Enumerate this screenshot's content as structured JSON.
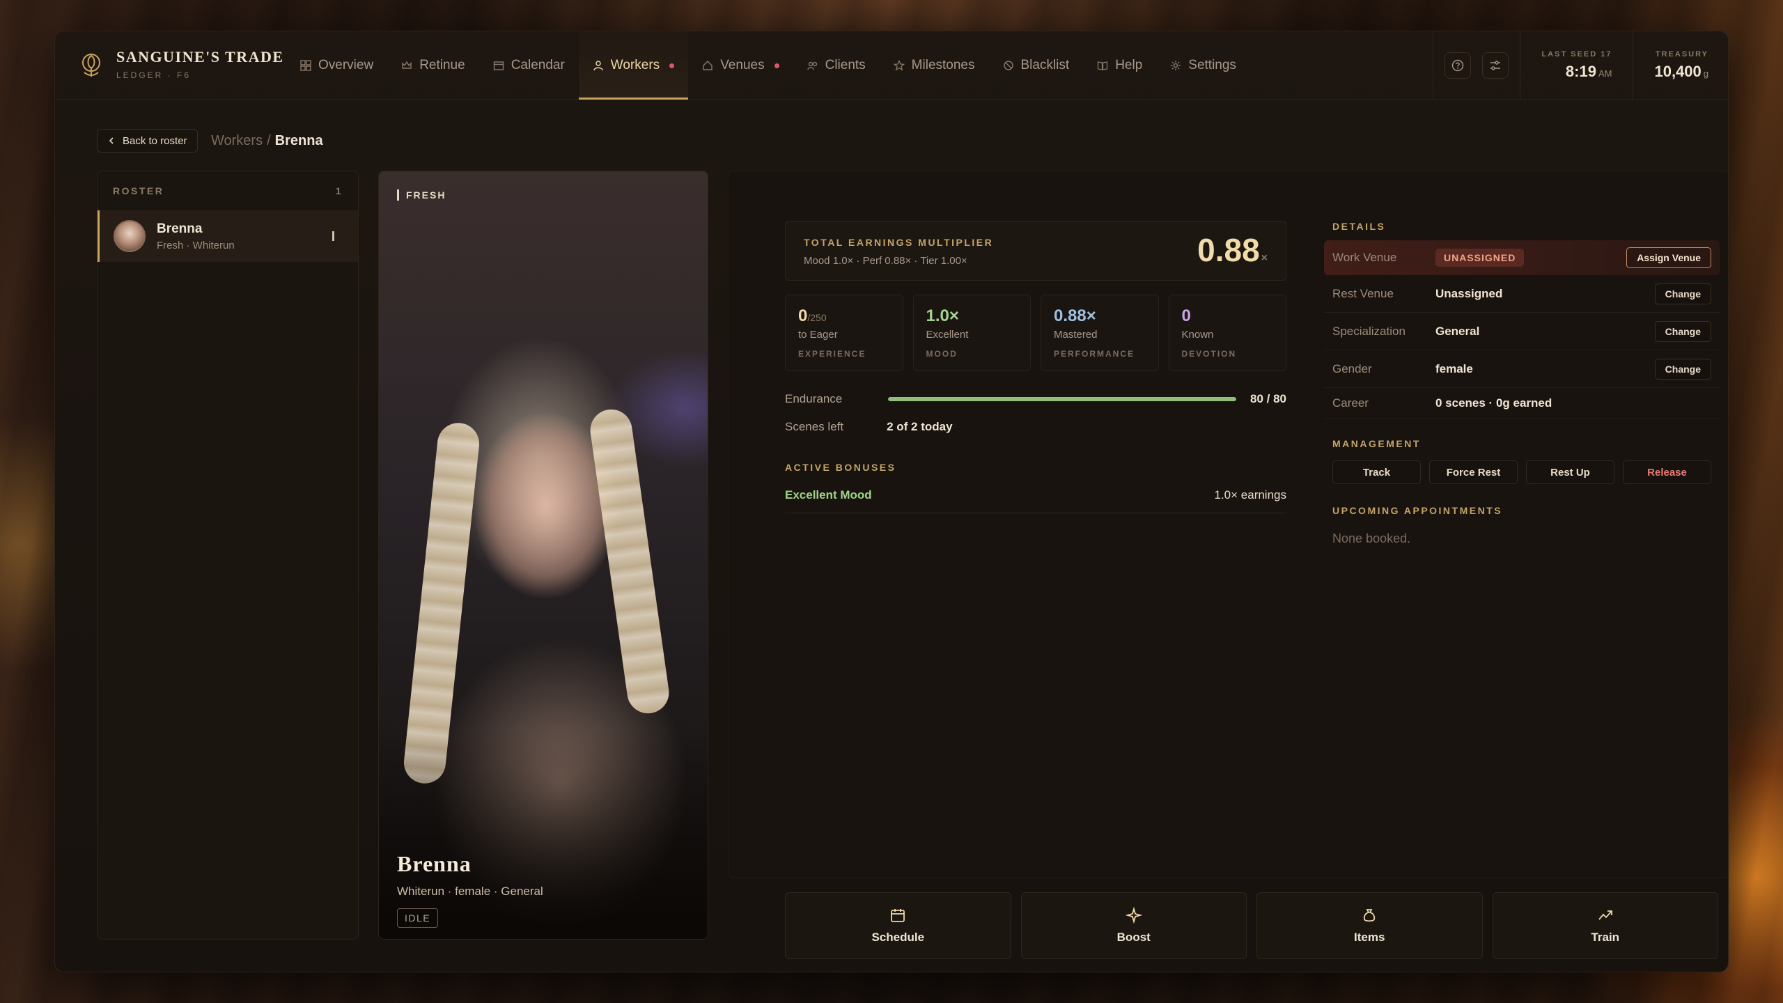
{
  "brand": {
    "title": "SANGUINE'S TRADE",
    "subtitle": "LEDGER · F6"
  },
  "nav": [
    {
      "label": "Overview",
      "icon": "grid-icon",
      "active": false,
      "dot": false
    },
    {
      "label": "Retinue",
      "icon": "crown-icon",
      "active": false,
      "dot": false
    },
    {
      "label": "Calendar",
      "icon": "calendar-icon",
      "active": false,
      "dot": false
    },
    {
      "label": "Workers",
      "icon": "person-icon",
      "active": true,
      "dot": true
    },
    {
      "label": "Venues",
      "icon": "house-icon",
      "active": false,
      "dot": true
    },
    {
      "label": "Clients",
      "icon": "people-icon",
      "active": false,
      "dot": false
    },
    {
      "label": "Milestones",
      "icon": "star-icon",
      "active": false,
      "dot": false
    },
    {
      "label": "Blacklist",
      "icon": "ban-icon",
      "active": false,
      "dot": false
    },
    {
      "label": "Help",
      "icon": "book-icon",
      "active": false,
      "dot": false
    },
    {
      "label": "Settings",
      "icon": "gear-icon",
      "active": false,
      "dot": false
    }
  ],
  "status": {
    "last_seed_label": "LAST SEED 17",
    "time": "8:19",
    "ampm": "AM",
    "treasury_label": "TREASURY",
    "treasury": "10,400",
    "treasury_unit": "g"
  },
  "breadcrumb": {
    "back": "Back to roster",
    "parent": "Workers",
    "sep": "/",
    "current": "Brenna"
  },
  "roster": {
    "title": "ROSTER",
    "count": "1",
    "items": [
      {
        "name": "Brenna",
        "sub": "Fresh · Whiterun"
      }
    ]
  },
  "portrait": {
    "tag": "FRESH",
    "name": "Brenna",
    "sub": "Whiterun · female · General",
    "badge": "IDLE"
  },
  "multiplier": {
    "label": "TOTAL EARNINGS MULTIPLIER",
    "breakdown": "Mood 1.0× · Perf 0.88× · Tier 1.00×",
    "value": "0.88",
    "suffix": "×"
  },
  "stats": [
    {
      "value": "0",
      "suffix": "/250",
      "sub": "to Eager",
      "label": "EXPERIENCE",
      "color": "#f1dba8"
    },
    {
      "value": "1.0×",
      "suffix": "",
      "sub": "Excellent",
      "label": "MOOD",
      "color": "#a6d38f"
    },
    {
      "value": "0.88×",
      "suffix": "",
      "sub": "Mastered",
      "label": "PERFORMANCE",
      "color": "#9cc0e0"
    },
    {
      "value": "0",
      "suffix": "",
      "sub": "Known",
      "label": "DEVOTION",
      "color": "#c9a4e8"
    }
  ],
  "endurance": {
    "label": "Endurance",
    "current": 80,
    "max": 80,
    "text": "80 / 80"
  },
  "scenes": {
    "label": "Scenes left",
    "value": "2 of 2 today"
  },
  "active_bonuses": {
    "title": "ACTIVE BONUSES",
    "items": [
      {
        "name": "Excellent Mood",
        "effect": "1.0× earnings"
      }
    ]
  },
  "details": {
    "title": "DETAILS",
    "work_venue": {
      "key": "Work Venue",
      "value": "UNASSIGNED",
      "button": "Assign Venue"
    },
    "rest_venue": {
      "key": "Rest Venue",
      "value": "Unassigned",
      "button": "Change"
    },
    "specialization": {
      "key": "Specialization",
      "value": "General",
      "button": "Change"
    },
    "gender": {
      "key": "Gender",
      "value": "female",
      "button": "Change"
    },
    "career": {
      "key": "Career",
      "value": "0 scenes · 0g earned"
    }
  },
  "management": {
    "title": "MANAGEMENT",
    "buttons": [
      "Track",
      "Force Rest",
      "Rest Up",
      "Release"
    ]
  },
  "appointments": {
    "title": "UPCOMING APPOINTMENTS",
    "empty": "None booked."
  },
  "actions": [
    {
      "label": "Schedule",
      "icon": "calendar-icon"
    },
    {
      "label": "Boost",
      "icon": "sparkle-icon"
    },
    {
      "label": "Items",
      "icon": "pouch-icon"
    },
    {
      "label": "Train",
      "icon": "trend-up-icon"
    }
  ]
}
